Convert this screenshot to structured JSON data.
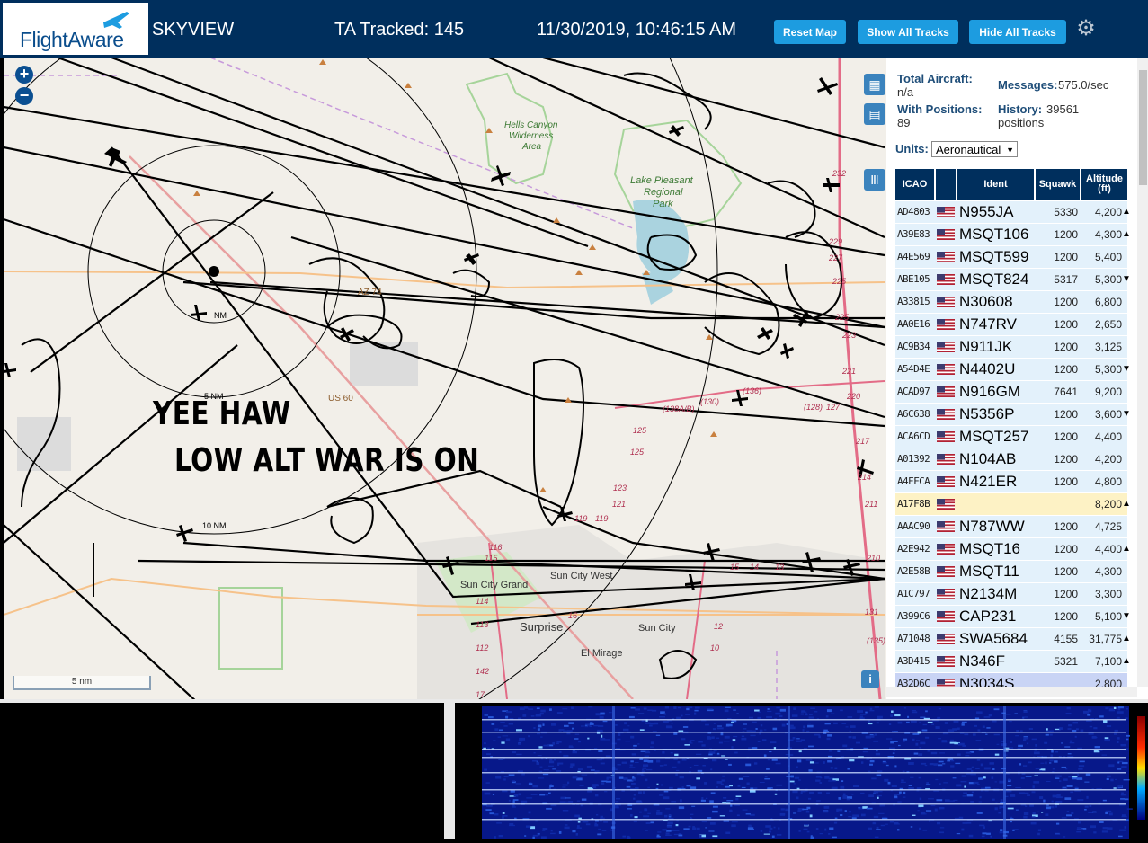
{
  "header": {
    "logo_text": "FlightAware",
    "app_name": "SKYVIEW",
    "tracked": "TA Tracked: 145",
    "datetime": "11/30/2019, 10:46:15 AM",
    "btn_reset": "Reset Map",
    "btn_show": "Show All Tracks",
    "btn_hide": "Hide All Tracks",
    "settings_icon": "gear-icon"
  },
  "map": {
    "zoom_in": "+",
    "zoom_out": "−",
    "overlay_line1": "YEE HAW",
    "overlay_line2": "LOW ALT WAR IS ON",
    "scale_label": "5 nm",
    "ring_5": "5 NM",
    "ring_10": "10 NM",
    "ring_nm": "NM",
    "places": {
      "hells_canyon": "Hells Canyon",
      "wilderness": "Wilderness",
      "area": "Area",
      "lake": "Lake Pleasant",
      "regional": "Regional",
      "park": "Park",
      "az74": "AZ 74",
      "us60": "US 60",
      "sun_city_grand": "Sun City Grand",
      "sun_city_west": "Sun City West",
      "surprise": "Surprise",
      "sun_city": "Sun City",
      "el_mirage": "El Mirage"
    },
    "road_numbers": [
      "232",
      "229",
      "227",
      "225",
      "225",
      "223",
      "221",
      "220",
      "217",
      "214",
      "211",
      "210",
      "131",
      "(135)",
      "(130)",
      "(136)",
      "(138A/B)",
      "(128)",
      "127",
      "125",
      "125",
      "123",
      "121",
      "119",
      "119",
      "116",
      "115",
      "114",
      "113",
      "112",
      "142",
      "17",
      "16",
      "15",
      "14",
      "13",
      "12",
      "10"
    ],
    "info_icon": "info-icon",
    "map_icon": "map-icon",
    "grid_icon": "grid-icon",
    "columns_icon": "columns-icon"
  },
  "sidebar": {
    "total_aircraft_label": "Total Aircraft:",
    "total_aircraft_value": "n/a",
    "with_positions_label": "With Positions:",
    "with_positions_value": "89",
    "messages_label": "Messages:",
    "messages_value": "575.0/sec",
    "history_label": "History:",
    "history_value": "39561",
    "history_unit": "positions",
    "units_label": "Units:",
    "units_value": "Aeronautical",
    "columns": [
      "ICAO",
      "Ident",
      "Squawk",
      "Altitude (ft)"
    ],
    "rows": [
      {
        "icao": "AD4803",
        "ident": "N955JA",
        "squawk": "5330",
        "alt": "4,200",
        "trend": "▲"
      },
      {
        "icao": "A39E83",
        "ident": "MSQT106",
        "squawk": "1200",
        "alt": "4,300",
        "trend": "▲"
      },
      {
        "icao": "A4E569",
        "ident": "MSQT599",
        "squawk": "1200",
        "alt": "5,400",
        "trend": ""
      },
      {
        "icao": "ABE105",
        "ident": "MSQT824",
        "squawk": "5317",
        "alt": "5,300",
        "trend": "▼"
      },
      {
        "icao": "A33815",
        "ident": "N30608",
        "squawk": "1200",
        "alt": "6,800",
        "trend": ""
      },
      {
        "icao": "AA0E16",
        "ident": "N747RV",
        "squawk": "1200",
        "alt": "2,650",
        "trend": ""
      },
      {
        "icao": "AC9B34",
        "ident": "N911JK",
        "squawk": "1200",
        "alt": "3,125",
        "trend": ""
      },
      {
        "icao": "A54D4E",
        "ident": "N4402U",
        "squawk": "1200",
        "alt": "5,300",
        "trend": "▼"
      },
      {
        "icao": "ACAD97",
        "ident": "N916GM",
        "squawk": "7641",
        "alt": "9,200",
        "trend": ""
      },
      {
        "icao": "A6C638",
        "ident": "N5356P",
        "squawk": "1200",
        "alt": "3,600",
        "trend": "▼"
      },
      {
        "icao": "ACA6CD",
        "ident": "MSQT257",
        "squawk": "1200",
        "alt": "4,400",
        "trend": ""
      },
      {
        "icao": "A01392",
        "ident": "N104AB",
        "squawk": "1200",
        "alt": "4,200",
        "trend": ""
      },
      {
        "icao": "A4FFCA",
        "ident": "N421ER",
        "squawk": "1200",
        "alt": "4,800",
        "trend": ""
      },
      {
        "icao": "A17F8B",
        "ident": "",
        "squawk": "",
        "alt": "8,200",
        "trend": "▲"
      },
      {
        "icao": "AAAC90",
        "ident": "N787WW",
        "squawk": "1200",
        "alt": "4,725",
        "trend": ""
      },
      {
        "icao": "A2E942",
        "ident": "MSQT16",
        "squawk": "1200",
        "alt": "4,400",
        "trend": "▲"
      },
      {
        "icao": "A2E58B",
        "ident": "MSQT11",
        "squawk": "1200",
        "alt": "4,300",
        "trend": ""
      },
      {
        "icao": "A1C797",
        "ident": "N2134M",
        "squawk": "1200",
        "alt": "3,300",
        "trend": ""
      },
      {
        "icao": "A399C6",
        "ident": "CAP231",
        "squawk": "1200",
        "alt": "5,100",
        "trend": "▼"
      },
      {
        "icao": "A71048",
        "ident": "SWA5684",
        "squawk": "4155",
        "alt": "31,775",
        "trend": "▲"
      },
      {
        "icao": "A3D415",
        "ident": "N346F",
        "squawk": "5321",
        "alt": "7,100",
        "trend": "▲"
      },
      {
        "icao": "A32D6C",
        "ident": "N3034S",
        "squawk": "",
        "alt": "2,800",
        "trend": ""
      }
    ]
  },
  "colors": {
    "header_bg": "#002f5d",
    "button_bg": "#1d9ce0",
    "row_bg": "#e3f1fb",
    "row_highlight_yellow": "#fdf2c5",
    "row_highlight_blue": "#c9d4f5"
  }
}
